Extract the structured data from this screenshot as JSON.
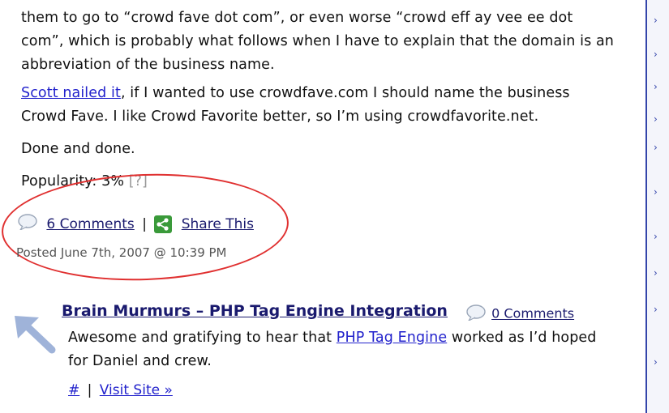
{
  "post": {
    "para1_line1": "them to go to “crowd fave dot com”, or even worse “crowd eff ay vee ee dot",
    "para1_line2": "com”, which is probably what follows when I have to explain that the domain is an",
    "para1_line3": "abbreviation of the business name.",
    "para2_link": "Scott nailed it",
    "para2_line1_rest": ", if I wanted to use crowdfave.com I should name the business",
    "para2_line2": "Crowd Fave. I like Crowd Favorite better, so I’m using crowdfavorite.net.",
    "para3": "Done and done.",
    "popularity_label": "Popularity: 3%",
    "popularity_help": "[?]",
    "comments_link": "6 Comments",
    "separator": "|",
    "share_link": "Share This",
    "posted": "Posted June 7th, 2007 @ 10:39 PM"
  },
  "tumblelog": {
    "title": "Brain Murmurs – PHP Tag Engine Integration",
    "comments_link": "0 Comments",
    "body_before": "Awesome and gratifying to hear that ",
    "body_link": "PHP Tag Engine",
    "body_after": " worked as I’d hoped",
    "body_line2": "for Daniel and crew.",
    "permalink": "#",
    "separator": "|",
    "visit_link": "Visit Site »"
  },
  "icons": {
    "comment": "speech-bubble-icon",
    "share": "share-icon",
    "arrow": "arrow-up-left-icon",
    "rail": "chevron-right-icon"
  },
  "colors": {
    "link": "#2222cc",
    "annotation": "#e03030",
    "share_green": "#3a9a3a",
    "rail_border": "#3344aa"
  }
}
